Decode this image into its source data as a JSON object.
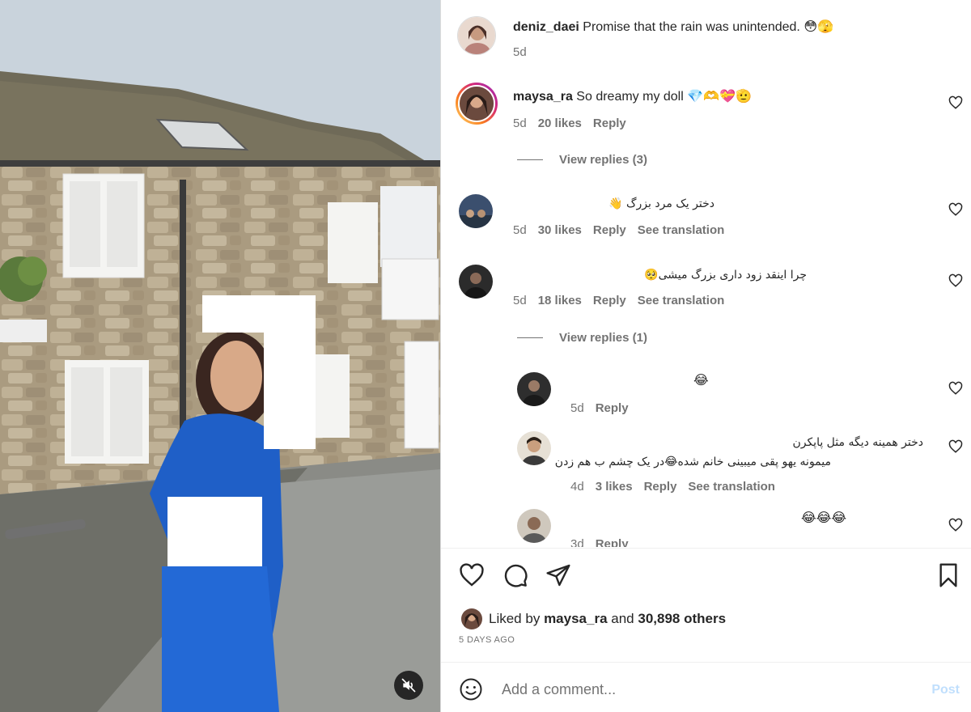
{
  "post": {
    "author": "deniz_daei",
    "caption": "Promise that the rain was unintended. 😳🫣",
    "time": "5d"
  },
  "comments": [
    {
      "user": "maysa_ra",
      "text": "So dreamy my doll 💎🫶💝🫡",
      "time": "5d",
      "likes": "20 likes",
      "reply": "Reply",
      "view_replies": "View replies (3)"
    },
    {
      "user": "",
      "text": "دختر یک مرد بزرگ 👋",
      "time": "5d",
      "likes": "30 likes",
      "reply": "Reply",
      "translation": "See translation"
    },
    {
      "user": "",
      "text": "چرا اینقد زود داری بزرگ میشی🥺",
      "time": "5d",
      "likes": "18 likes",
      "reply": "Reply",
      "translation": "See translation",
      "view_replies": "View replies (1)"
    }
  ],
  "replies": [
    {
      "text": "😂",
      "time": "5d",
      "reply": "Reply"
    },
    {
      "line1": "دختر همینه دیگه مثل پاپکرن",
      "line2": "میمونه یهو پقی میبینی خانم شده😂در یک چشم ب هم زدن",
      "time": "4d",
      "likes": "3 likes",
      "reply": "Reply",
      "translation": "See translation"
    },
    {
      "text": "😂😂😂",
      "time": "3d",
      "reply": "Reply"
    }
  ],
  "likes_summary": {
    "prefix": "Liked by",
    "user": "maysa_ra",
    "middle": "and",
    "others": "30,898 others"
  },
  "posted_ago": "5 DAYS AGO",
  "comment_box": {
    "placeholder": "Add a comment...",
    "post_label": "Post"
  },
  "colors": {
    "text": "#262626",
    "muted": "#737373",
    "divider": "#dbdbdb",
    "post_disabled": "#c0dffd",
    "story_ring_start": "#feda75",
    "story_ring_end": "#d62976"
  },
  "icons": [
    "heart-icon",
    "comment-icon",
    "share-icon",
    "bookmark-icon",
    "emoji-icon",
    "mute-icon"
  ]
}
